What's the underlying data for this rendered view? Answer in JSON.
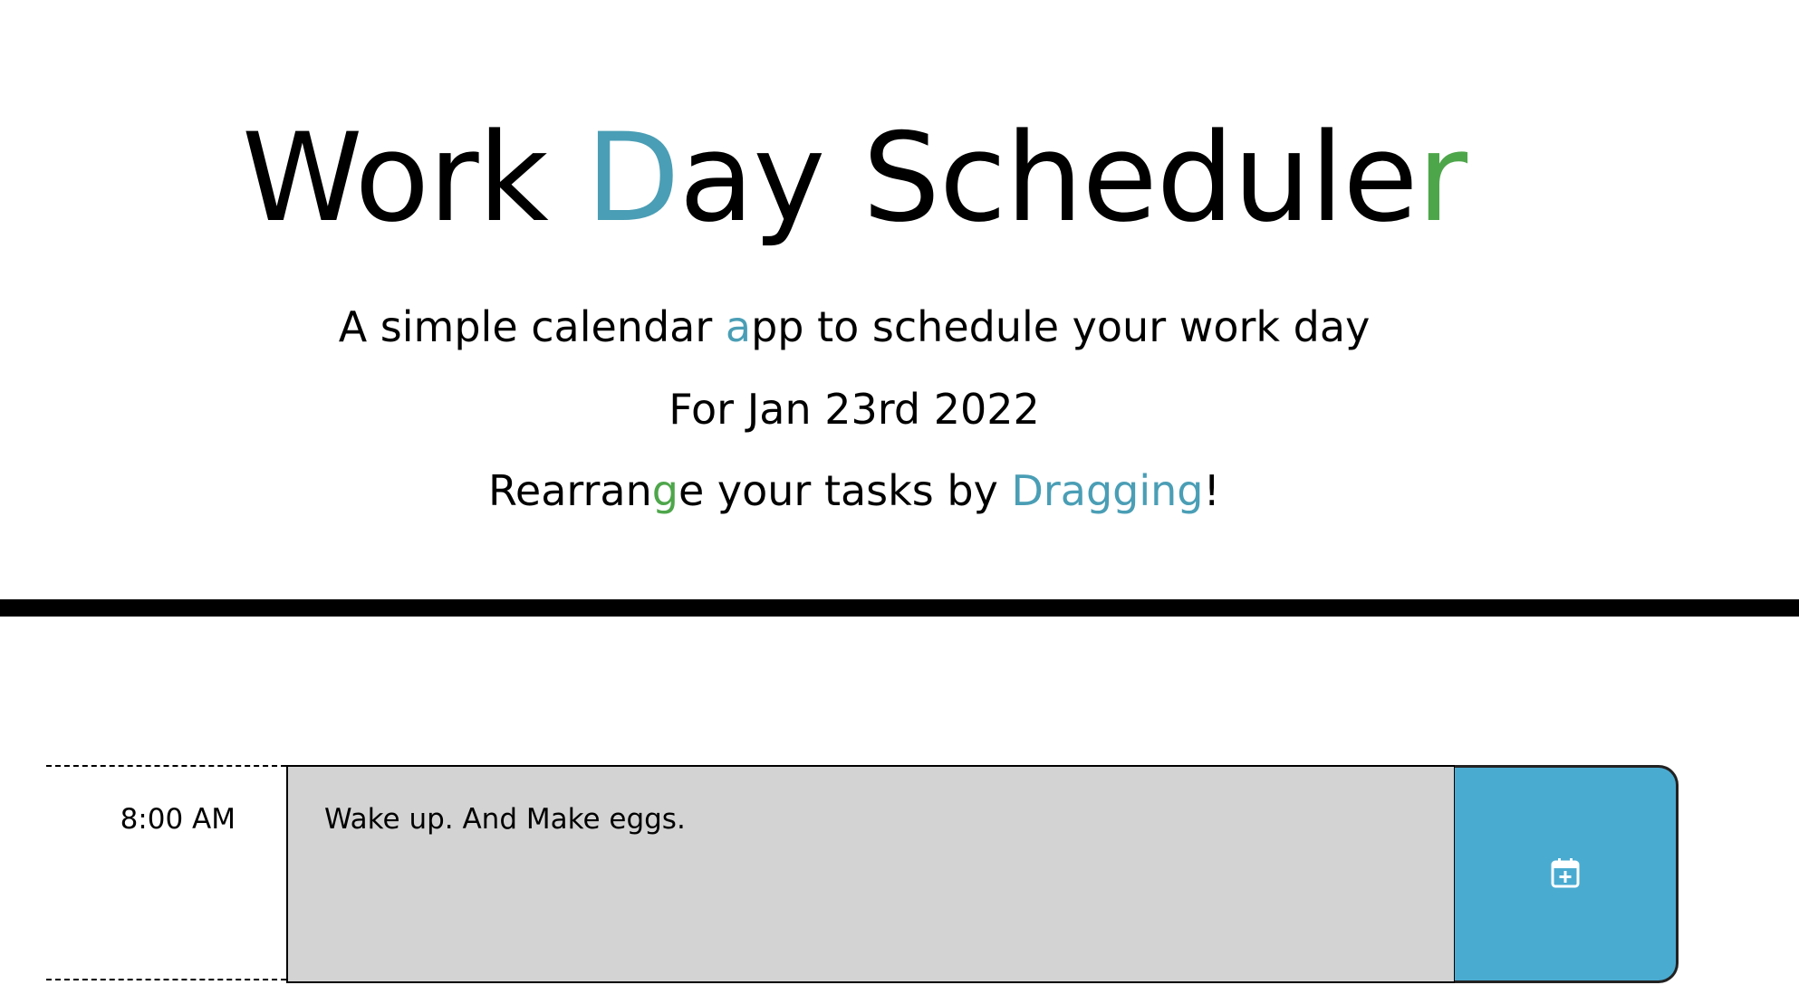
{
  "header": {
    "title": {
      "part1": "Work ",
      "accent1": "D",
      "part2": "ay Schedule",
      "accent2": "r"
    },
    "lead": {
      "part1": "A simple calendar ",
      "accent": "a",
      "part2": "pp to schedule your work day"
    },
    "date_line": "For Jan 23rd 2022",
    "drag_hint": {
      "part1": "Rearran",
      "accent1": "g",
      "part2": "e your tasks by ",
      "accent2": "Dragging",
      "part3": "!"
    }
  },
  "colors": {
    "accent_blue": "#4a9eb5",
    "accent_green": "#4ea64b",
    "task_past": "#d3d3d3",
    "save_button": "#4aabd1"
  },
  "schedule": {
    "rows": [
      {
        "hour": "8:00 AM",
        "task": "Wake up. And Make eggs.",
        "save_icon": "calendar-plus-icon"
      }
    ]
  }
}
